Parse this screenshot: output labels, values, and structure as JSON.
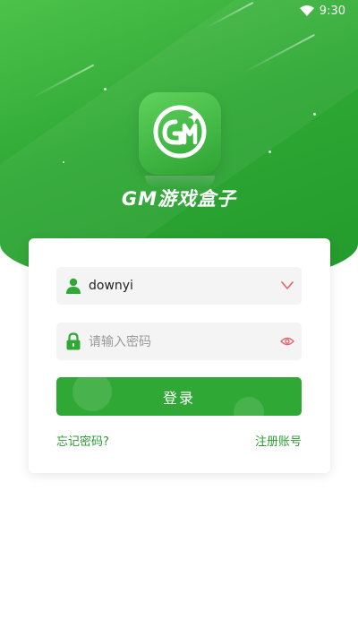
{
  "status_bar": {
    "time": "9:30"
  },
  "app": {
    "name": "GM游戏盒子"
  },
  "form": {
    "username_value": "downyi",
    "password_placeholder": "请输入密码",
    "login_label": "登录",
    "forgot_label": "忘记密码?",
    "register_label": "注册账号"
  },
  "colors": {
    "brand_green": "#2fa835",
    "link_green": "#2b9b31",
    "icon_red": "#e5606a"
  },
  "icons": [
    "wifi-icon",
    "gm-logo-icon",
    "user-icon",
    "chevron-down-icon",
    "lock-icon",
    "eye-icon"
  ]
}
